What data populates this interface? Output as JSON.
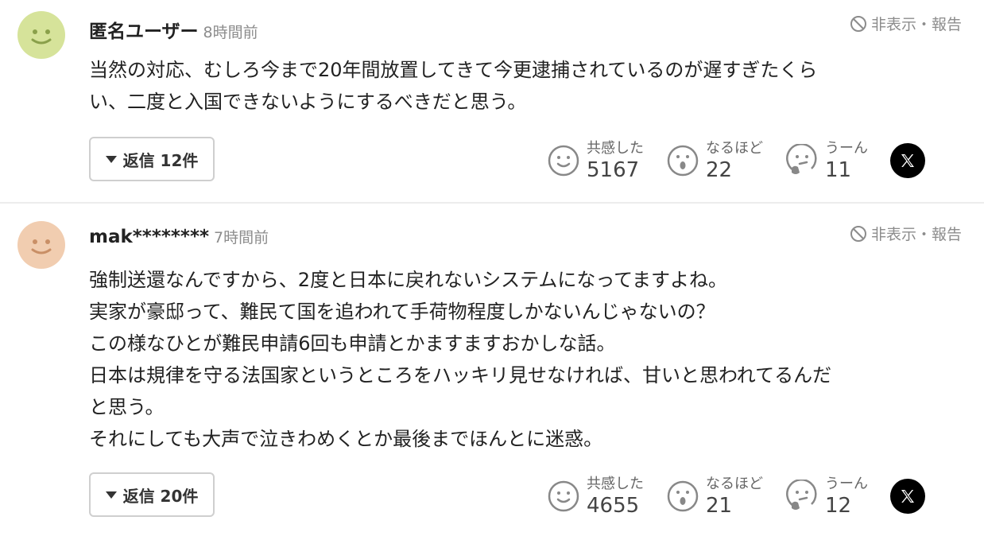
{
  "comments": [
    {
      "author": "匿名ユーザー",
      "time": "8時間前",
      "hide_report": "非表示・報告",
      "body_lines": [
        "当然の対応、むしろ今まで20年間放置してきて今更逮捕されているのが遅すぎたくら",
        "い、二度と入国できないようにするべきだと思う。"
      ],
      "replies": "返信 12件",
      "reactions": [
        {
          "label": "共感した",
          "count": "5167",
          "icon": "smile-face-icon"
        },
        {
          "label": "なるほど",
          "count": "22",
          "icon": "surprised-face-icon"
        },
        {
          "label": "うーん",
          "count": "11",
          "icon": "thinking-face-icon"
        }
      ],
      "avatar_color": "#d6e39a"
    },
    {
      "author": "mak********",
      "time": "7時間前",
      "hide_report": "非表示・報告",
      "body_lines": [
        "強制送還なんですから、2度と日本に戻れないシステムになってますよね。",
        "実家が豪邸って、難民て国を追われて手荷物程度しかないんじゃないの？",
        "この様なひとが難民申請6回も申請とかますますおかしな話。",
        "日本は規律を守る法国家というところをハッキリ見せなければ、甘いと思われてるんだ",
        "と思う。",
        "それにしても大声で泣きわめくとか最後までほんとに迷惑。"
      ],
      "replies": "返信 20件",
      "reactions": [
        {
          "label": "共感した",
          "count": "4655",
          "icon": "smile-face-icon"
        },
        {
          "label": "なるほど",
          "count": "21",
          "icon": "surprised-face-icon"
        },
        {
          "label": "うーん",
          "count": "12",
          "icon": "thinking-face-icon"
        }
      ],
      "avatar_color": "#f1cdb0"
    }
  ],
  "icons": {
    "share": "x-logo-icon",
    "hide": "prohibited-icon"
  }
}
